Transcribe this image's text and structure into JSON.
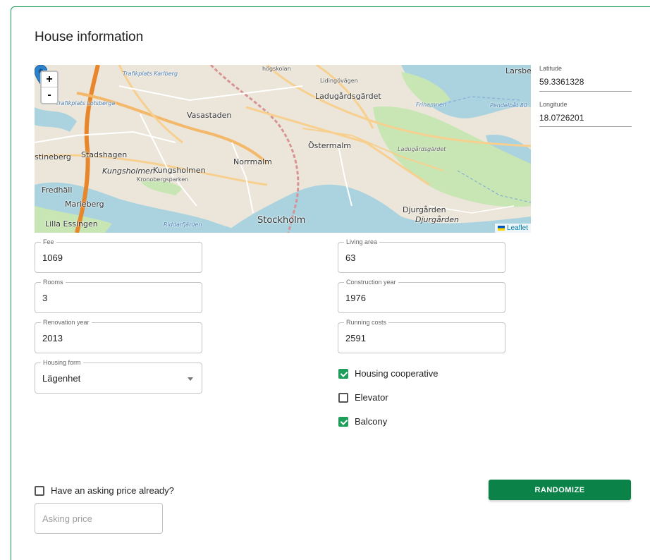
{
  "section_title": "House information",
  "map": {
    "zoom_in": "+",
    "zoom_out": "-",
    "attribution": "Leaflet",
    "labels": {
      "vasastaden": "Vasastaden",
      "ladugardsgardet": "Ladugårdsgärdet",
      "ostermalm": "Östermalm",
      "norrmalm": "Norrmalm",
      "kungsholmen1": "Kungsholmen",
      "kungsholmen2": "Kungsholmen",
      "stadshagen": "Stadshagen",
      "stineberg": "stineberg",
      "fredhall": "Fredhäll",
      "marieberg": "Marieberg",
      "lilla_essingen": "Lilla Essingen",
      "stockholm": "Stockholm",
      "djurgarden1": "Djurgården",
      "djurgarden2": "Djurgården",
      "larsberg": "Larsber",
      "frihamnen": "Frihamnen",
      "ladugardsgardet_small": "Ladugårdsgärdet",
      "kronobergsparken": "Kronobergsparken",
      "riddarfjarden": "Riddarfjärden",
      "trafikplats_karlberg": "Trafikplats Karlberg",
      "trafikplats_lotsberga": "Trafikplats Lotsberga",
      "pendelbat": "Pendelbåt 80",
      "hogskolan": "högskolan",
      "lidingovagen": "Lidingövägen"
    }
  },
  "coords": {
    "latitude_label": "Latitude",
    "latitude_value": "59.3361328",
    "longitude_label": "Longitude",
    "longitude_value": "18.0726201"
  },
  "fields": {
    "fee": {
      "label": "Fee",
      "value": "1069"
    },
    "living_area": {
      "label": "Living area",
      "value": "63"
    },
    "rooms": {
      "label": "Rooms",
      "value": "3"
    },
    "construction_year": {
      "label": "Construction year",
      "value": "1976"
    },
    "renovation_year": {
      "label": "Renovation year",
      "value": "2013"
    },
    "running_costs": {
      "label": "Running costs",
      "value": "2591"
    },
    "housing_form": {
      "label": "Housing form",
      "value": "Lägenhet"
    }
  },
  "checkboxes": {
    "housing_cooperative": {
      "label": "Housing cooperative",
      "checked": true
    },
    "elevator": {
      "label": "Elevator",
      "checked": false
    },
    "balcony": {
      "label": "Balcony",
      "checked": true
    },
    "asking_price": {
      "label": "Have an asking price already?",
      "checked": false
    }
  },
  "asking_price_placeholder": "Asking price",
  "randomize_label": "RANDOMIZE",
  "colors": {
    "accent": "#0b8247",
    "border": "#1e9e5a",
    "marker": "#2b82cb"
  }
}
